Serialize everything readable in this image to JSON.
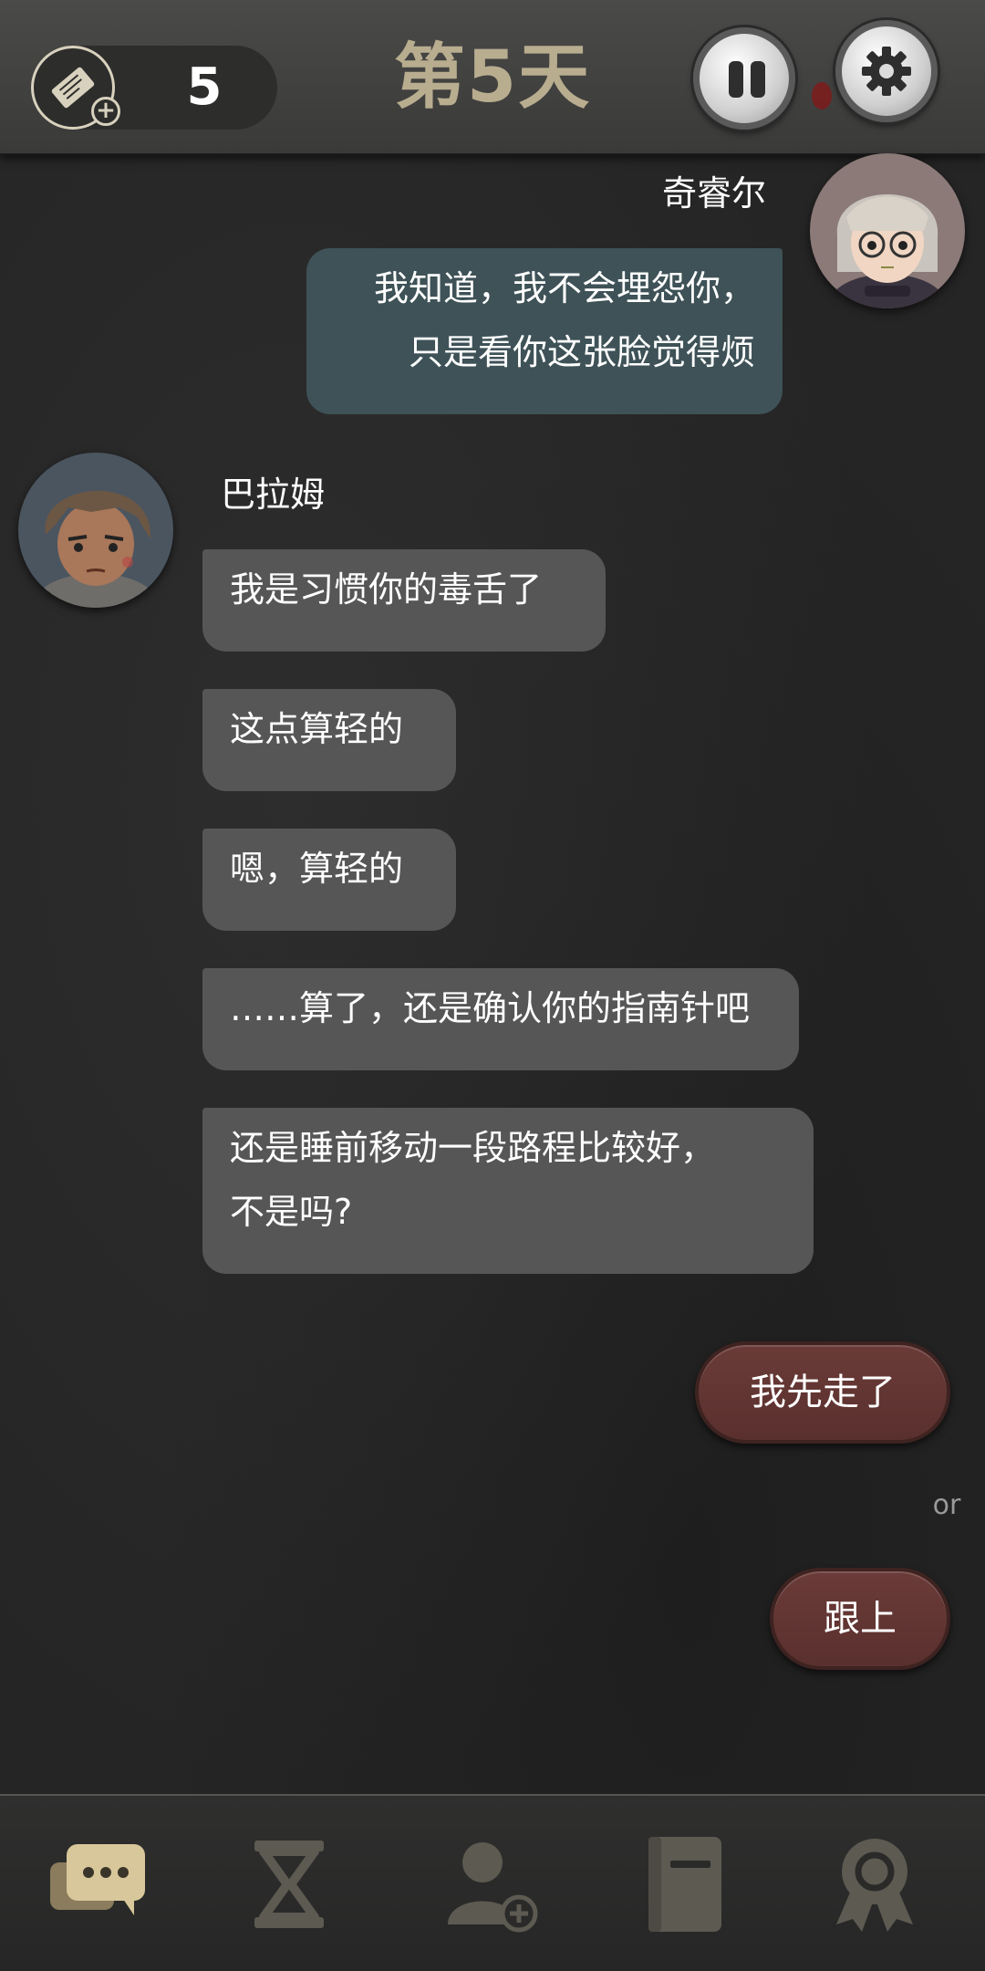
{
  "header": {
    "ticket_count": "5",
    "day_title": "第5天"
  },
  "chat": {
    "speaker_right": "奇睿尔",
    "message_right": "我知道，我不会埋怨你，\n只是看你这张脸觉得烦",
    "speaker_left": "巴拉姆",
    "messages_left": [
      "我是习惯你的毒舌了",
      "这点算轻的",
      "嗯，算轻的",
      "……算了，还是确认你的指南针吧",
      "还是睡前移动一段路程比较好，\n不是吗?"
    ]
  },
  "choices": {
    "option_1": "我先走了",
    "or_label": "or",
    "option_2": "跟上"
  },
  "bottom_nav": {
    "items": [
      "chat-icon",
      "hourglass-icon",
      "add-person-icon",
      "book-icon",
      "badge-icon"
    ],
    "active_color": "#d8c79a",
    "inactive_color": "#5d5a52"
  },
  "colors": {
    "grey_bubble": "#565656",
    "teal_bubble": "#3e5257",
    "choice_button": "#5f3431",
    "day_title": "#b9ad90"
  }
}
